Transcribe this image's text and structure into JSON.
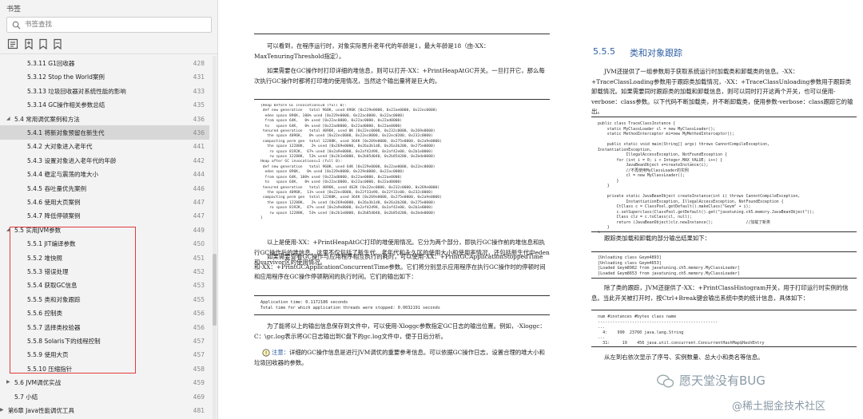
{
  "sidebar": {
    "title": "书签",
    "search_placeholder": "书签查找",
    "tools": [
      "bookmark-expand-icon",
      "bookmark-add-icon",
      "bookmark-outline-icon",
      "bookmark-flag-icon"
    ],
    "items": [
      {
        "level": 3,
        "label": "5.3.11 G1回收器",
        "page": "428"
      },
      {
        "level": 3,
        "label": "5.3.12 Stop the World案例",
        "page": "431"
      },
      {
        "level": 3,
        "label": "5.3.13 垃圾回收器对系统性能的影响",
        "page": "433"
      },
      {
        "level": 3,
        "label": "5.3.14 GC操作相关参数总结",
        "page": "435"
      },
      {
        "level": 2,
        "label": "5.4 常用调优案例和方法",
        "page": "436",
        "expanded": true
      },
      {
        "level": 3,
        "label": "5.4.1 将新对象预留在新生代",
        "page": "436",
        "selected": true
      },
      {
        "level": 3,
        "label": "5.4.2 大对象进入老年代",
        "page": "441"
      },
      {
        "level": 3,
        "label": "5.4.3 设置对象进入老年代的年龄",
        "page": "442"
      },
      {
        "level": 3,
        "label": "5.4.4 稳定与震荡的堆大小",
        "page": "444"
      },
      {
        "level": 3,
        "label": "5.4.5 吞吐量优先案例",
        "page": "446"
      },
      {
        "level": 3,
        "label": "5.4.6 使用大页案例",
        "page": "447"
      },
      {
        "level": 3,
        "label": "5.4.7 降低停顿案例",
        "page": "447"
      },
      {
        "level": 2,
        "label": "5.5 实用JVM参数",
        "page": "449",
        "expanded": true
      },
      {
        "level": 3,
        "label": "5.5.1 JIT编译参数",
        "page": "450"
      },
      {
        "level": 3,
        "label": "5.5.2 堆快照",
        "page": "451"
      },
      {
        "level": 3,
        "label": "5.5.3 错误处理",
        "page": "452"
      },
      {
        "level": 3,
        "label": "5.5.4 获取GC信息",
        "page": "453"
      },
      {
        "level": 3,
        "label": "5.5.5 类和对象跟踪",
        "page": "455"
      },
      {
        "level": 3,
        "label": "5.5.6 控制类",
        "page": "456"
      },
      {
        "level": 3,
        "label": "5.5.7 选择类校验器",
        "page": "456"
      },
      {
        "level": 3,
        "label": "5.5.8 Solaris下的线程控制",
        "page": "457"
      },
      {
        "level": 3,
        "label": "5.5.9 使用大页",
        "page": "457"
      },
      {
        "level": 3,
        "label": "5.5.10 压缩指针",
        "page": "458"
      },
      {
        "level": 2,
        "label": "5.6 JVM调优实战",
        "page": "459",
        "collapsed": true
      },
      {
        "level": 2,
        "label": "5.7 小结",
        "page": "469"
      },
      {
        "level": 1,
        "label": "第6章 Java性能调优工具",
        "page": "481",
        "collapsed": true
      }
    ]
  },
  "left_page": {
    "p1": "可以看到，在程序运行时，对象实际晋升老年代的年龄是1，最大年龄是18（由-XX：MaxTenuringThreshold指定）。",
    "p2": "如果需要在GC操作时打印详细的堆信息，则可以打开-XX：+PrintHeapAtGC开关。一旦打开它，那么每次执行GC操作时都将打印堆的使用情况，当然这个输出量将是巨大的。",
    "code1": "{Heap before GC invocations=0 (full 0):\n def new generation   total 960K, used 896K [0x229e0000, 0x22ae0000, 0x22ec0000)\n  eden space 896K, 100% used [0x229e0000, 0x22ac0000, 0x22ac0000)\n  from space 64K,   0% used [0x22ac0000, 0x22ac0000, 0x22ad0000)\n  to   space 64K,   0% used [0x22ad0000, 0x22ad0000, 0x22ae0000)\n tenured generation   total 4096K, used 0K [0x22ec0000, 0x232c0000, 0x269e0000)\n   the space 4096K,   0% used [0x22ec0000, 0x22ec0000, 0x22ec0200, 0x232c0000)\n compacting perm gen  total 12288K, used 364K [0x269e0000, 0x275e0000, 0x2a9e0000)\n   the space 12288K,   2% used [0x269e0000, 0x26a3b1d8, 0x26a3b200, 0x275e0000)\n    ro space 8192K,  67% used [0x2a9e0000, 0x2af42d98, 0x2af42e00, 0x2b1e0000)\n    rw space 12288K,  53% used [0x2b1e0000, 0x2b85d040, 0x2b85d200, 0x2bde0000)\nHeap after GC invocations=1 (full 0):\n def new generation   total 960K, used 64K [0x229e0000, 0x22ae0000, 0x22ec0000)\n  eden space 896K,   0% used [0x229e0000, 0x229e0000, 0x22ac0000)\n  from space 64K, 100% used [0x22ad0000, 0x22ae0000, 0x22ae0000)\n  to   space 64K,   0% used [0x22ac0000, 0x22ac0000, 0x22ad0000)\n tenured generation   total 4096K, used 462K [0x22ec0000, 0x232c0000, 0x269e0000)\n   the space 4096K,  11% used [0x22ec0000, 0x22f33a98, 0x22f33c00, 0x232c0000)\n compacting perm gen  total 12288K, used 364K [0x269e0000, 0x275e0000, 0x2a9e0000)\n   the space 12288K,   2% used [0x269e0000, 0x26a3b1d8, 0x26a3b200, 0x275e0000)\n    ro space 8192K,  67% used [0x2a9e0000, 0x2af42d98, 0x2af42e00, 0x2b1e0000)\n    rw space 12288K,  53% used [0x2b1e0000, 0x2b85d040, 0x2b85d200, 0x2bde0000)\n}",
    "p3": "以上是使用-XX：+PrintHeapAtGC打印的堆使用情况。它分为两个部分，即执行GC操作前的堆信息和执行GC操作后的堆信息。这里不仅包括了新生代、老年代和永久区的使用大小和使用率情况，还包括新生代中eden和survivor区的使用情况。",
    "p4": "如果需要查看GC操作与应用程序相互执行的耗时，可以使用-XX：+PrintGCApplicationStoppedTime和-XX：+PrintGCApplicationConcurrentTime参数。它们将分别显示应用程序在执行GC操作时的停顿时间和应用程序在GC操作停顿期间的执行时间。它们的输出如下：",
    "code2": "Application time: 0.1172186 seconds\nTotal time for which application threads were stopped: 0.0032191 seconds",
    "p5": "为了能将以上的输出信息保存到文件中，可以使用-Xloggc参数指定GC日志的输出位置。例如，-Xloggc：C：\\gc.log表示将GC日志输出到C盘下的gc.log文件中，便于日后分析。",
    "note_label": "注意：",
    "p6": "详细的GC操作信息是进行JVM调优的重要参考信息。可以依据GC操作日志，设置合理的堆大小和垃圾回收器的参数。"
  },
  "right_page": {
    "section_no": "5.5.5",
    "section_title": "类和对象跟踪",
    "p1": "JVM还提供了一组参数用于获取系统运行时加载类和卸载类的信息。-XX：+TraceClassLoading参数用于跟踪类加载情况，-XX：+TraceClassUnloading参数用于跟踪类卸载情况。如果需要同时跟踪类的加载和卸载信息，则可以同时打开这两个开关，也可以使用-verbose：class参数。以下代码不断加载类，并不断卸载类，使用参数-verbose：class跟踪它的输出。",
    "code1": "public class TraceClassInstance {\n    static MyClassLoader cl = new MyClassLoader();\n    static MethodInterceptor mi=new MyMethodInterceptor();\n\n    public static void main(String[] args) throws CannotCompileException,\nInstantiationException,\n            IllegalAccessException, NotFoundException {\n        for (int i = 0; i < Integer.MAX_VALUE; i++) {\n            JavaBeanObject v=createInstance(i);\n            //不再使用MyClassLoader的实例\n            cl = new MyClassLoader();\n        }\n    }\n\n    private static JavaBeanObject createInstance(int i) throws CannotCompileException,\n            InstantiationException, IllegalAccessException, NotFoundException {\n        CtClass c = ClassPool.getDefault().makeClass(\"Geym\" + i);\n        c.setSuperclass(ClassPool.getDefault().get(\"javatuning.ch5.memory.JavaBeanObject\"));\n        Class clz = c.toClass(cl, null);\n        return (JavaBeanObject)clz.newInstance();              //加载了新类\n    }\n}",
    "p2": "跟踪类加载和卸载的部分输出结果如下：",
    "code2": "[Unloading class Geym4893]\n[Unloading class Geym4653]\n[Loaded Geym8982 from javatuning.ch5.memory.MyClassLoader]\n[Loaded Geym8653 from javatuning.ch5.memory.MyClassLoader]",
    "p3": "除了类的跟踪，JVM还提供了-XX：+PrintClassHistogram开关，用于打印运行时实例的信息。当此开关被打开时，按Ctrl+Break键会输出系统中类的统计信息，具体如下：",
    "code3": "num #instances #bytes class name\n-------------------------------------------------\n...\n  4:    990  23760 java.lang.String\n...\n  31:     19    456 java.util.concurrent.ConcurrentHashMap$HashEntry",
    "p4": "从左到右依次显示了序号、实例数量、总大小和类名等信息。"
  },
  "watermarks": {
    "w1": "愿天堂没有BUG",
    "w2": "@稀土掘金技术社区"
  },
  "colors": {
    "accent": "#2e5fa3",
    "highlight_box": "#e23b3b",
    "selected_row": "#d7d7d7"
  }
}
